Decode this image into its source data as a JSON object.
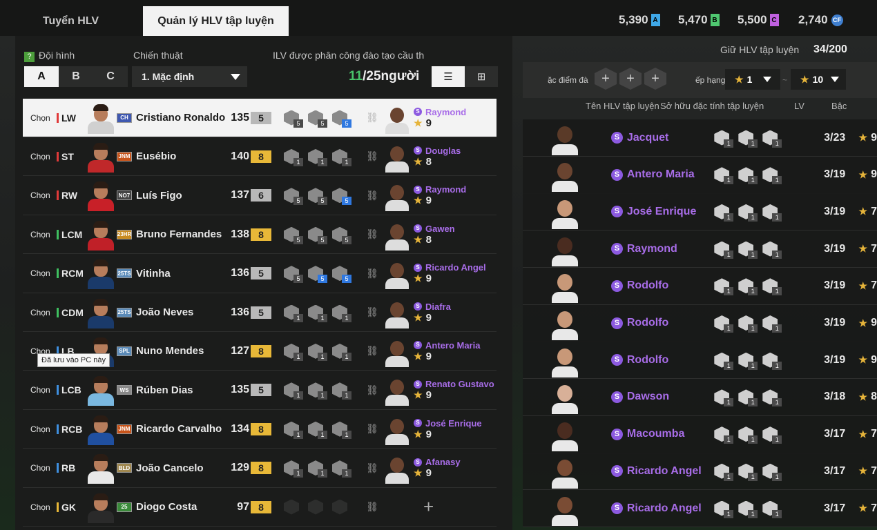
{
  "tabs": {
    "recruit": "Tuyển HLV",
    "manage": "Quản lý HLV tập luyện"
  },
  "currency": [
    {
      "value": "5,390",
      "tag": "A",
      "color": "#3fa8e8"
    },
    {
      "value": "5,470",
      "tag": "B",
      "color": "#4fc870"
    },
    {
      "value": "5,500",
      "tag": "C",
      "color": "#c060e0"
    },
    {
      "value": "2,740",
      "tag": "CF",
      "color": "#3f7fd0"
    }
  ],
  "left": {
    "formation_label": "Đội hình",
    "tactic_label": "Chiến thuật",
    "assigned_label": "ILV được phân công đào tạo cầu th",
    "formations": [
      "A",
      "B",
      "C"
    ],
    "tactic_value": "1. Mặc định",
    "count_current": "11",
    "count_total": "/25người",
    "tooltip": "Đã lưu vào PC này",
    "players": [
      {
        "pos": "LW",
        "pos_color": "#e03a3a",
        "name": "Cristiano Ronaldo",
        "ovr": "135",
        "lvl": "5",
        "lvl_color": "#b8b8b8",
        "season": "CH",
        "season_color": "#3f58b0",
        "skills": [
          "5",
          "5",
          "5"
        ],
        "blue": [
          false,
          false,
          true
        ],
        "coach": "Raymond",
        "stars": "9",
        "kit": "#d0d0d0"
      },
      {
        "pos": "ST",
        "pos_color": "#e03a3a",
        "name": "Eusébio",
        "ovr": "140",
        "lvl": "8",
        "lvl_color": "#e8b838",
        "season": "JNM",
        "season_color": "#c8541a",
        "skills": [
          "1",
          "1",
          "1"
        ],
        "blue": [
          false,
          false,
          false
        ],
        "coach": "Douglas",
        "stars": "8",
        "kit": "#c0282a"
      },
      {
        "pos": "RW",
        "pos_color": "#e03a3a",
        "name": "Luís Figo",
        "ovr": "137",
        "lvl": "6",
        "lvl_color": "#b8b8b8",
        "season": "NO7",
        "season_color": "#444",
        "skills": [
          "5",
          "5",
          "5"
        ],
        "blue": [
          false,
          false,
          true
        ],
        "coach": "Raymond",
        "stars": "9",
        "kit": "#c82028"
      },
      {
        "pos": "LCM",
        "pos_color": "#3fc060",
        "name": "Bruno Fernandes",
        "ovr": "138",
        "lvl": "8",
        "lvl_color": "#e8b838",
        "season": "23HR",
        "season_color": "#c88a20",
        "skills": [
          "5",
          "5",
          "5"
        ],
        "blue": [
          false,
          false,
          false
        ],
        "coach": "Gawen",
        "stars": "8",
        "kit": "#c02028"
      },
      {
        "pos": "RCM",
        "pos_color": "#3fc060",
        "name": "Vitinha",
        "ovr": "136",
        "lvl": "5",
        "lvl_color": "#b8b8b8",
        "season": "25TS",
        "season_color": "#5a8ab8",
        "skills": [
          "5",
          "5",
          "5"
        ],
        "blue": [
          false,
          true,
          true
        ],
        "coach": "Ricardo Angel",
        "stars": "9",
        "kit": "#1a3a6a"
      },
      {
        "pos": "CDM",
        "pos_color": "#3fc060",
        "name": "João Neves",
        "ovr": "136",
        "lvl": "5",
        "lvl_color": "#b8b8b8",
        "season": "25TS",
        "season_color": "#5a8ab8",
        "skills": [
          "1",
          "1",
          "1"
        ],
        "blue": [
          false,
          false,
          false
        ],
        "coach": "Diafra",
        "stars": "9",
        "kit": "#1a3a6a"
      },
      {
        "pos": "LB",
        "pos_color": "#3f90e0",
        "name": "Nuno Mendes",
        "ovr": "127",
        "lvl": "8",
        "lvl_color": "#e8b838",
        "season": "SPL",
        "season_color": "#5a8ab8",
        "skills": [
          "1",
          "1",
          "1"
        ],
        "blue": [
          false,
          false,
          false
        ],
        "coach": "Antero Maria",
        "stars": "9",
        "kit": "#1a3a6a"
      },
      {
        "pos": "LCB",
        "pos_color": "#3f90e0",
        "name": "Rúben Dias",
        "ovr": "135",
        "lvl": "5",
        "lvl_color": "#b8b8b8",
        "season": "WS",
        "season_color": "#888",
        "skills": [
          "1",
          "1",
          "1"
        ],
        "blue": [
          false,
          false,
          false
        ],
        "coach": "Renato Gustavo",
        "stars": "9",
        "kit": "#7ab8e0"
      },
      {
        "pos": "RCB",
        "pos_color": "#3f90e0",
        "name": "Ricardo Carvalho",
        "ovr": "134",
        "lvl": "8",
        "lvl_color": "#e8b838",
        "season": "JNM",
        "season_color": "#c8541a",
        "skills": [
          "1",
          "1",
          "1"
        ],
        "blue": [
          false,
          false,
          false
        ],
        "coach": "José Enrique",
        "stars": "9",
        "kit": "#2050a0"
      },
      {
        "pos": "RB",
        "pos_color": "#3f90e0",
        "name": "João Cancelo",
        "ovr": "129",
        "lvl": "8",
        "lvl_color": "#e8b838",
        "season": "BLD",
        "season_color": "#a08850",
        "skills": [
          "1",
          "1",
          "1"
        ],
        "blue": [
          false,
          false,
          false
        ],
        "coach": "Afanasy",
        "stars": "9",
        "kit": "#e8e8e8"
      },
      {
        "pos": "GK",
        "pos_color": "#e8b838",
        "name": "Diogo Costa",
        "ovr": "97",
        "lvl": "8",
        "lvl_color": "#e8b838",
        "season": "25",
        "season_color": "#3a8a3a",
        "skills": [],
        "blue": [],
        "coach": "",
        "stars": "",
        "kit": "#2a2a2a"
      }
    ],
    "chon": "Chọn"
  },
  "right": {
    "held_label": "Giữ HLV tập luyện",
    "held_value": "34/200",
    "filter_label": "ặc điểm đà",
    "rank_label": "ếp hạng",
    "rank_min": "1",
    "rank_max": "10",
    "rank_sep": "~",
    "col_name": "Tên HLV tập luyện",
    "col_traits": "Sở hữu đặc tính tập luyện",
    "col_lv": "LV",
    "col_rank": "Bậc",
    "coaches": [
      {
        "name": "Jacquet",
        "lv": "3/23",
        "rank": "9",
        "skin": "#5a3a28"
      },
      {
        "name": "Antero Maria",
        "lv": "3/19",
        "rank": "9",
        "skin": "#6a4430"
      },
      {
        "name": "José Enrique",
        "lv": "3/19",
        "rank": "7",
        "skin": "#c89878"
      },
      {
        "name": "Raymond",
        "lv": "3/19",
        "rank": "7",
        "skin": "#4a2c20"
      },
      {
        "name": "Rodolfo",
        "lv": "3/19",
        "rank": "7",
        "skin": "#c89878"
      },
      {
        "name": "Rodolfo",
        "lv": "3/19",
        "rank": "9",
        "skin": "#c89878"
      },
      {
        "name": "Rodolfo",
        "lv": "3/19",
        "rank": "9",
        "skin": "#c89878"
      },
      {
        "name": "Dawson",
        "lv": "3/18",
        "rank": "8",
        "skin": "#d8b098"
      },
      {
        "name": "Macoumba",
        "lv": "3/17",
        "rank": "7",
        "skin": "#4a2c20"
      },
      {
        "name": "Ricardo Angel",
        "lv": "3/17",
        "rank": "7",
        "skin": "#7a4c34"
      },
      {
        "name": "Ricardo Angel",
        "lv": "3/17",
        "rank": "7",
        "skin": "#7a4c34"
      }
    ]
  }
}
